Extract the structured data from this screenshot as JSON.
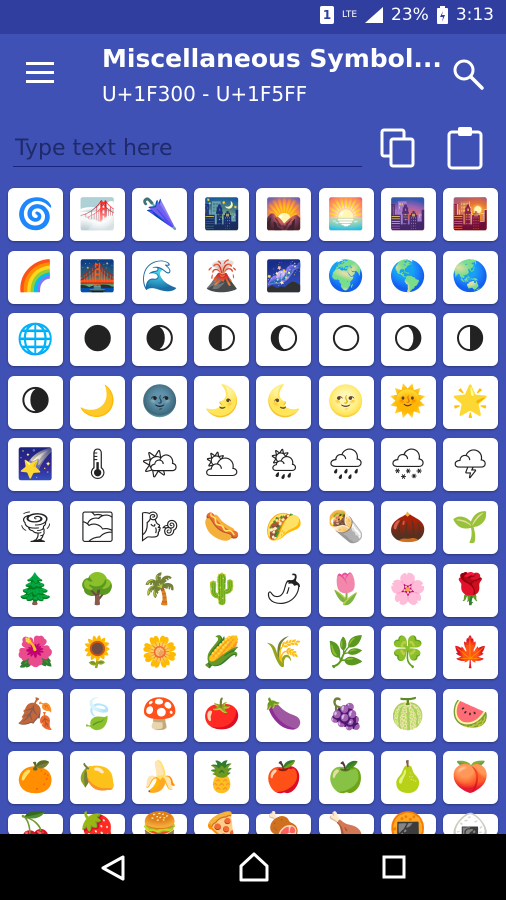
{
  "status_bar": {
    "sim_label": "1",
    "network": "LTE",
    "battery": "23%",
    "time": "3:13"
  },
  "app_bar": {
    "title": "Miscellaneous Symbol...",
    "subtitle": "U+1F300 - U+1F5FF"
  },
  "input": {
    "placeholder": "Type text here"
  },
  "symbols": [
    "🌀",
    "🌁",
    "🌂",
    "🌃",
    "🌄",
    "🌅",
    "🌆",
    "🌇",
    "🌈",
    "🌉",
    "🌊",
    "🌋",
    "🌌",
    "🌍",
    "🌎",
    "🌏",
    "🌐",
    "🌑",
    "🌒",
    "🌓",
    "🌔",
    "🌕",
    "🌖",
    "🌗",
    "🌘",
    "🌙",
    "🌚",
    "🌛",
    "🌜",
    "🌝",
    "🌞",
    "🌟",
    "🌠",
    "🌡",
    "🌤",
    "🌥",
    "🌦",
    "🌧",
    "🌨",
    "🌩",
    "🌪",
    "🌫",
    "🌬",
    "🌭",
    "🌮",
    "🌯",
    "🌰",
    "🌱",
    "🌲",
    "🌳",
    "🌴",
    "🌵",
    "🌶",
    "🌷",
    "🌸",
    "🌹",
    "🌺",
    "🌻",
    "🌼",
    "🌽",
    "🌾",
    "🌿",
    "🍀",
    "🍁",
    "🍂",
    "🍃",
    "🍄",
    "🍅",
    "🍆",
    "🍇",
    "🍈",
    "🍉",
    "🍊",
    "🍋",
    "🍌",
    "🍍",
    "🍎",
    "🍏",
    "🍐",
    "🍑",
    "🍒",
    "🍓",
    "🍔",
    "🍕",
    "🍖",
    "🍗",
    "🍘",
    "🍙"
  ],
  "visible_rows": 10,
  "columns": 8,
  "colors": {
    "primary": "#3f51b5",
    "primary_dark": "#303f9f",
    "cell_bg": "#ffffff"
  }
}
